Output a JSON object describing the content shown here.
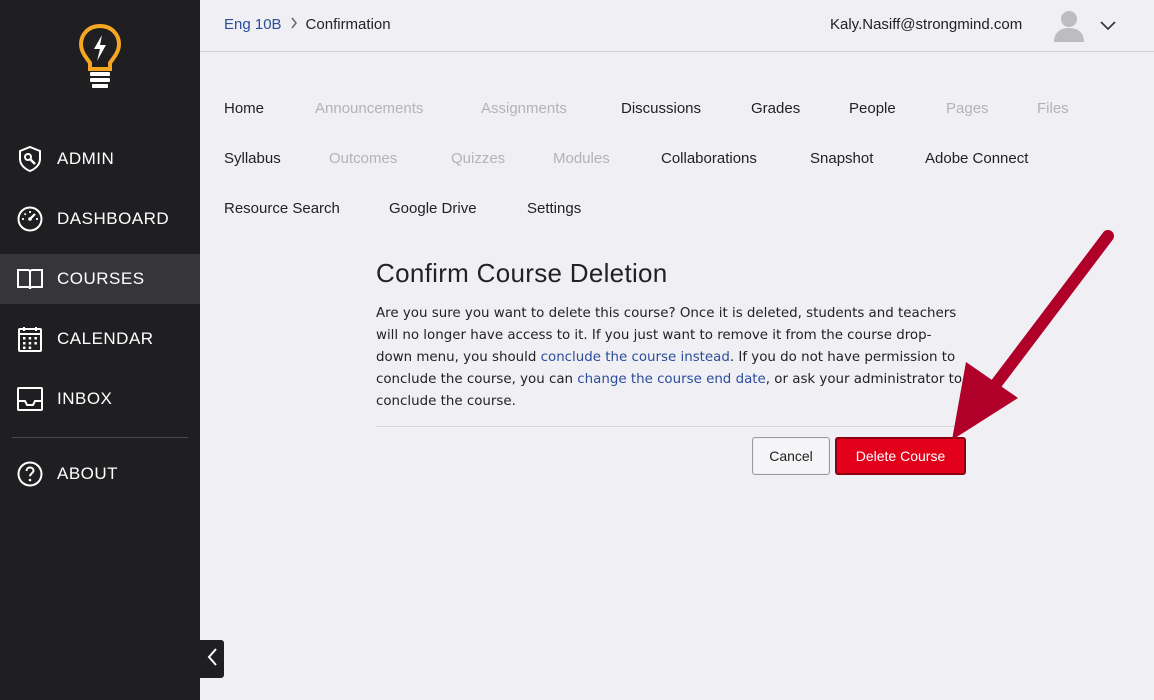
{
  "sidebar": {
    "items": [
      {
        "label": "ADMIN",
        "icon": "admin-shield-icon"
      },
      {
        "label": "DASHBOARD",
        "icon": "dashboard-gauge-icon"
      },
      {
        "label": "COURSES",
        "icon": "courses-book-icon",
        "active": true
      },
      {
        "label": "CALENDAR",
        "icon": "calendar-icon"
      },
      {
        "label": "INBOX",
        "icon": "inbox-tray-icon"
      },
      {
        "label": "ABOUT",
        "icon": "question-circle-icon"
      }
    ],
    "logo_icon": "lightbulb-logo-icon",
    "collapse_icon": "chevron-left-icon"
  },
  "header": {
    "breadcrumb": {
      "course": "Eng 10B",
      "current": "Confirmation"
    },
    "user_email": "Kaly.Nasiff@strongmind.com"
  },
  "course_nav": [
    {
      "label": "Home",
      "enabled": true
    },
    {
      "label": "Announcements",
      "enabled": false
    },
    {
      "label": "Assignments",
      "enabled": false
    },
    {
      "label": "Discussions",
      "enabled": true
    },
    {
      "label": "Grades",
      "enabled": true
    },
    {
      "label": "People",
      "enabled": true
    },
    {
      "label": "Pages",
      "enabled": false
    },
    {
      "label": "Files",
      "enabled": false
    },
    {
      "label": "Syllabus",
      "enabled": true
    },
    {
      "label": "Outcomes",
      "enabled": false
    },
    {
      "label": "Quizzes",
      "enabled": false
    },
    {
      "label": "Modules",
      "enabled": false
    },
    {
      "label": "Collaborations",
      "enabled": true
    },
    {
      "label": "Snapshot",
      "enabled": true
    },
    {
      "label": "Adobe Connect",
      "enabled": true
    },
    {
      "label": "Resource Search",
      "enabled": true
    },
    {
      "label": "Google Drive",
      "enabled": true
    },
    {
      "label": "Settings",
      "enabled": true
    }
  ],
  "dialog": {
    "title": "Confirm Course Deletion",
    "text_1": "Are you sure you want to delete this course? Once it is deleted, students and teachers will no longer have access to it. If you just want to remove it from the course drop-down menu, you should ",
    "link_1": "conclude the course instead",
    "text_2": ". If you do not have permission to conclude the course, you can ",
    "link_2": "change the course end date",
    "text_3": ", or ask your administrator to conclude the course.",
    "cancel_label": "Cancel",
    "delete_label": "Delete Course"
  },
  "colors": {
    "sidebar_bg": "#1f1f22",
    "accent_logo": "#f5a623",
    "link": "#2b4d9c",
    "delete_red": "#e2001a",
    "annotation_arrow": "#b0002a"
  }
}
